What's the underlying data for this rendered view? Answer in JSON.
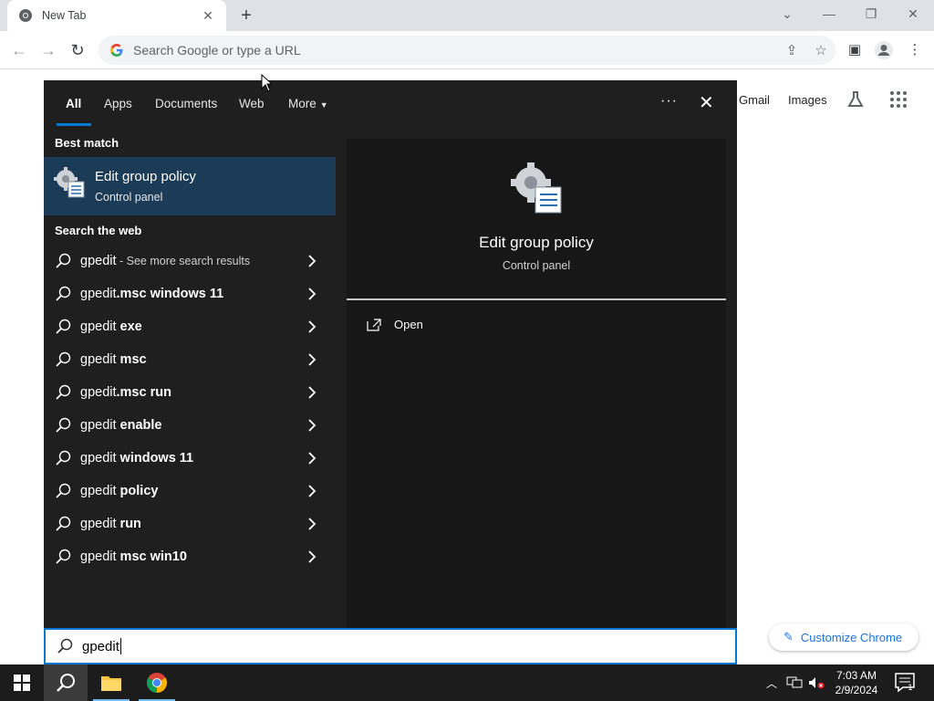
{
  "browser": {
    "tab": {
      "title": "New Tab",
      "favicon": "chrome-icon",
      "close": "close-icon"
    },
    "new_tab": "+",
    "window_controls": [
      "chevron-down-icon",
      "minimize-icon",
      "restore-icon",
      "close-icon"
    ],
    "omnibox": {
      "placeholder": "Search Google or type a URL",
      "icons": [
        "share-icon",
        "star-icon"
      ]
    },
    "toolbar_icons": [
      "back-icon",
      "forward-icon",
      "reload-icon",
      "sidepanel-icon",
      "profile-icon",
      "menu-icon"
    ]
  },
  "ntp": {
    "links": [
      "Gmail",
      "Images"
    ],
    "customize_label": "Customize Chrome"
  },
  "search": {
    "tabs": [
      "All",
      "Apps",
      "Documents",
      "Web",
      "More"
    ],
    "active_tab": "All",
    "best_match_header": "Best match",
    "best_match": {
      "title": "Edit group policy",
      "subtitle": "Control panel",
      "icon": "group-policy-icon"
    },
    "web_header": "Search the web",
    "web_items": [
      {
        "prefix": "gpedit",
        "bold": "",
        "sub": " - See more search results"
      },
      {
        "prefix": "gpedit",
        "bold": ".msc windows 11",
        "sub": ""
      },
      {
        "prefix": "gpedit ",
        "bold": "exe",
        "sub": ""
      },
      {
        "prefix": "gpedit ",
        "bold": "msc",
        "sub": ""
      },
      {
        "prefix": "gpedit",
        "bold": ".msc run",
        "sub": ""
      },
      {
        "prefix": "gpedit ",
        "bold": "enable",
        "sub": ""
      },
      {
        "prefix": "gpedit ",
        "bold": "windows 11",
        "sub": ""
      },
      {
        "prefix": "gpedit ",
        "bold": "policy",
        "sub": ""
      },
      {
        "prefix": "gpedit ",
        "bold": "run",
        "sub": ""
      },
      {
        "prefix": "gpedit ",
        "bold": "msc win10",
        "sub": ""
      }
    ],
    "preview": {
      "title": "Edit group policy",
      "subtitle": "Control panel",
      "open_label": "Open"
    },
    "query": "gpedit"
  },
  "taskbar": {
    "apps": [
      "windows-start-icon",
      "search-icon",
      "file-explorer-icon",
      "chrome-icon"
    ],
    "clock_time": "7:03 AM",
    "clock_date": "2/9/2024",
    "notification_count": "1"
  },
  "colors": {
    "accent": "#0078d4",
    "panel": "#1f1f1f",
    "selected": "#1b3b56",
    "taskbar": "#1c1c1c"
  }
}
